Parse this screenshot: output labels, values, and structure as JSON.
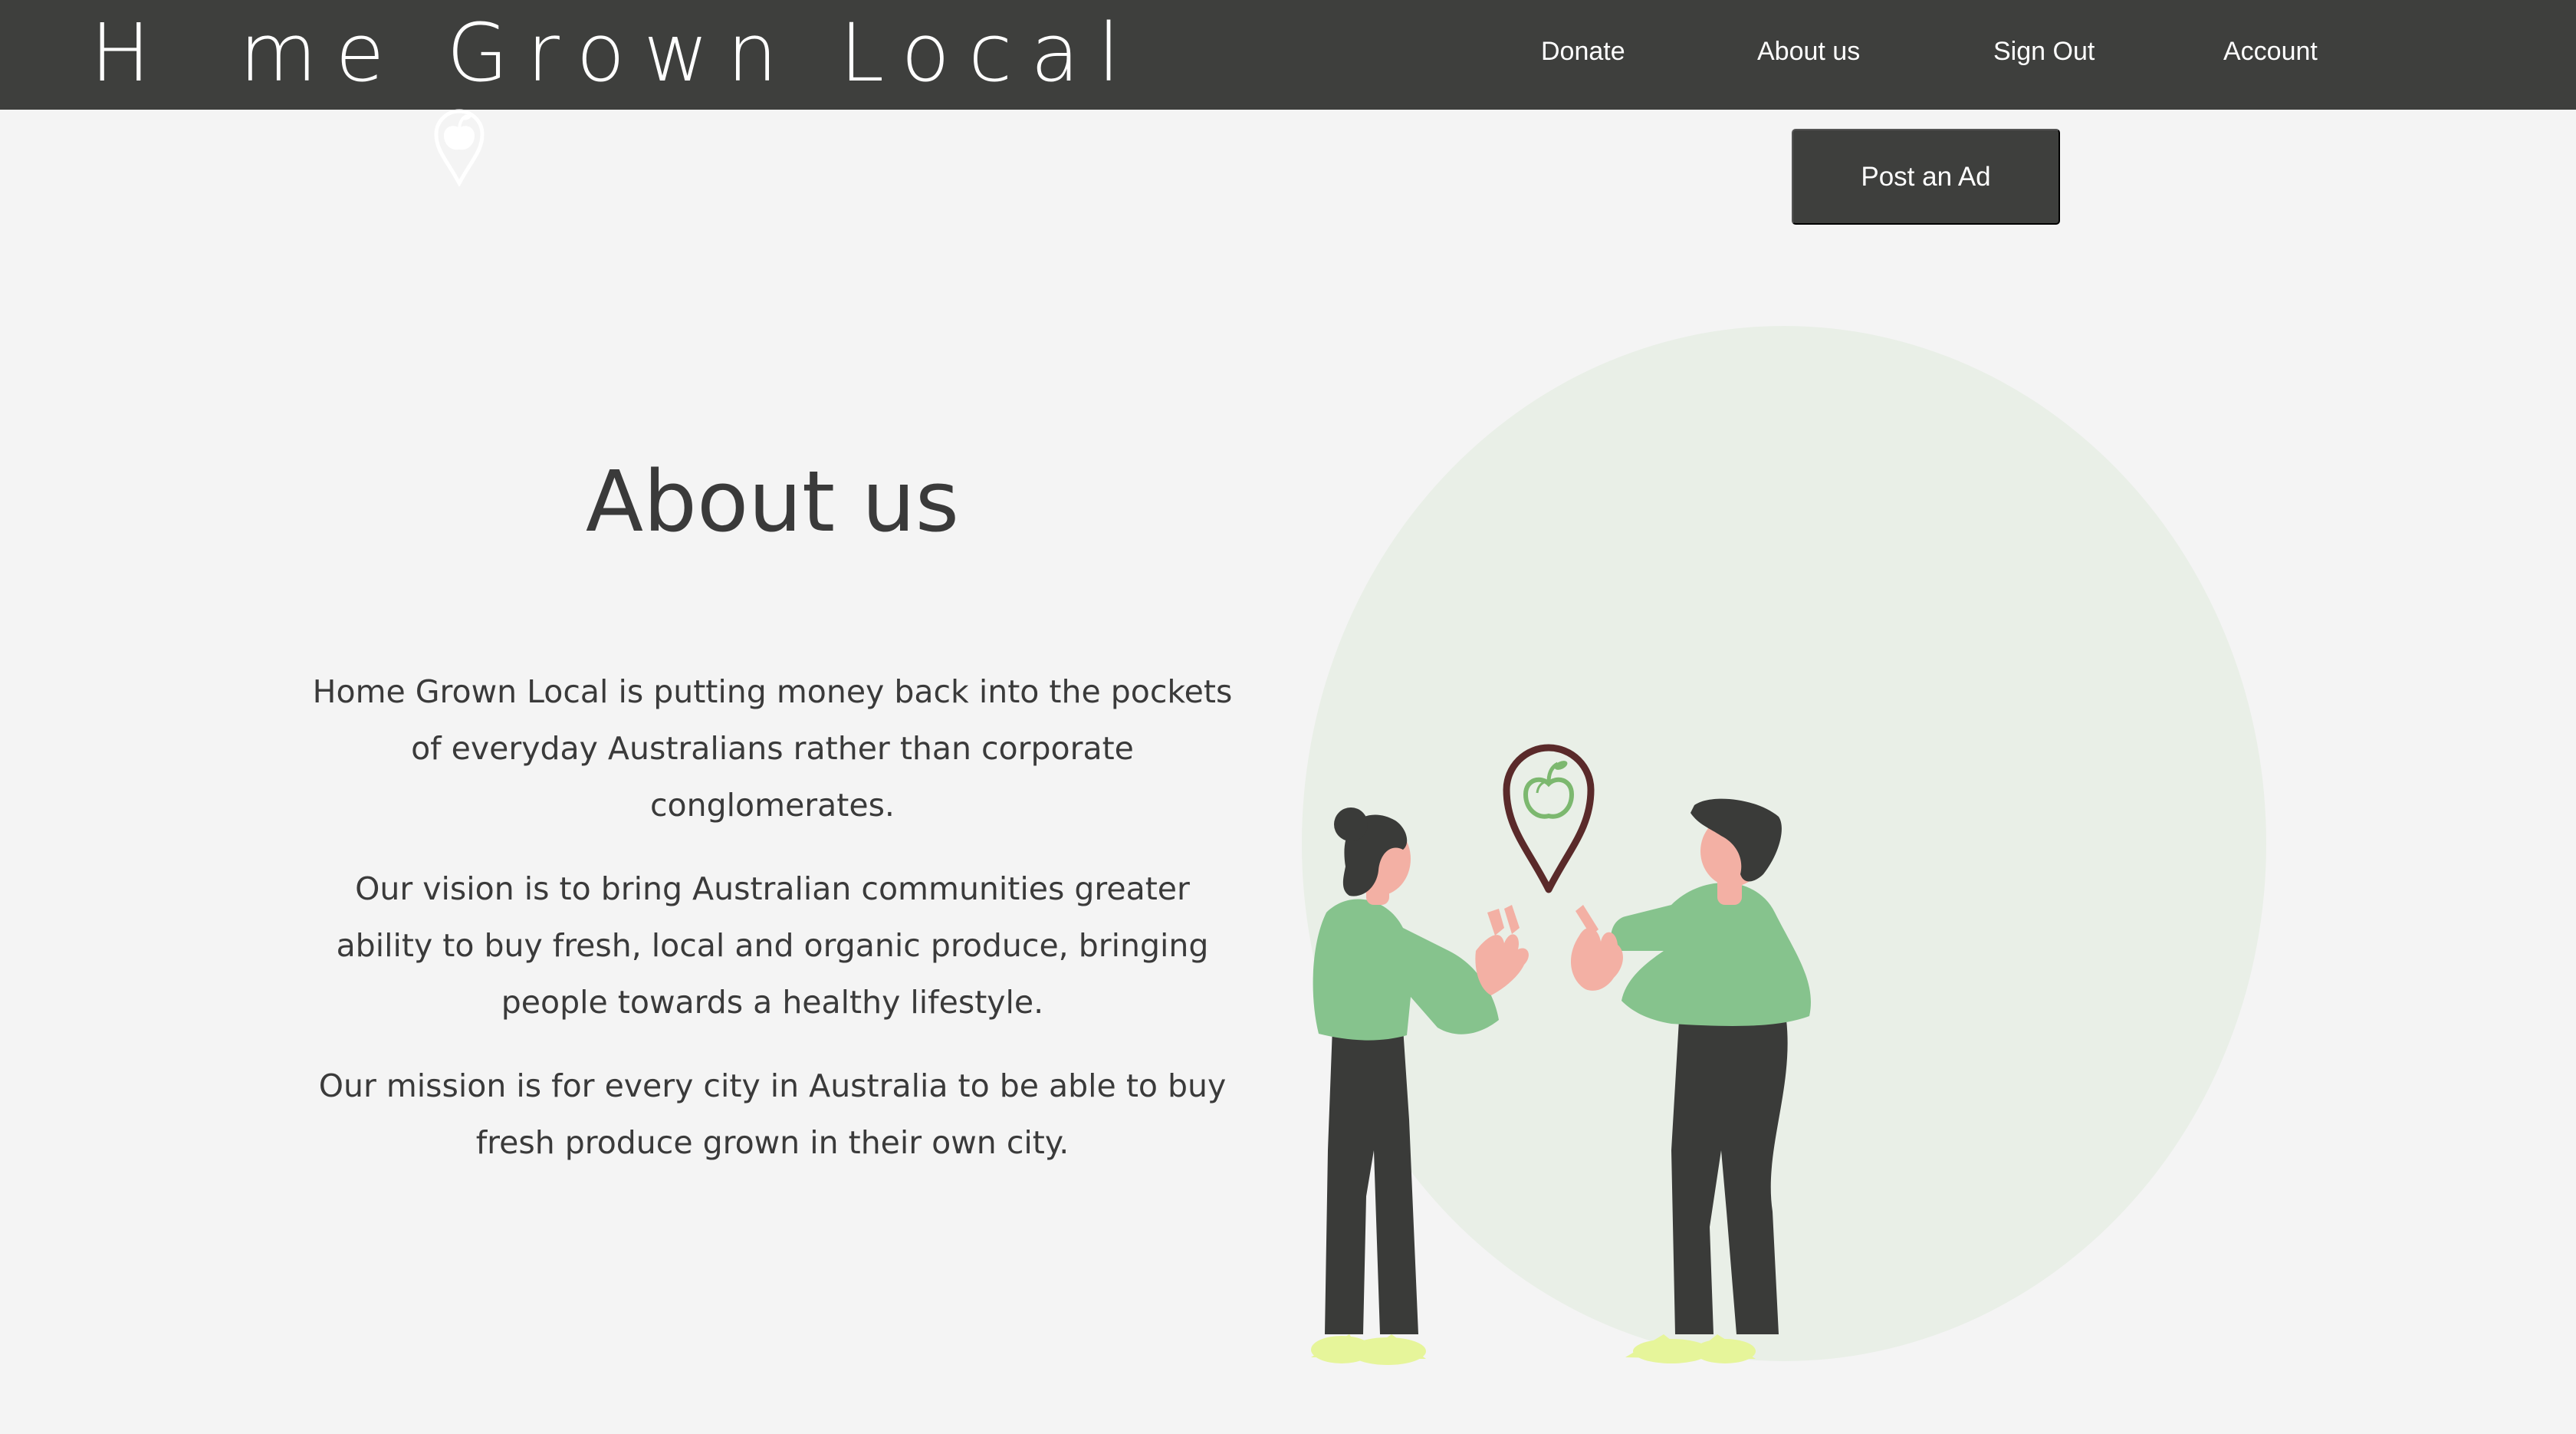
{
  "brand": {
    "name_part1": "H",
    "name_part2": "me Grown Local",
    "logo_icon": "apple-pin-icon"
  },
  "nav": {
    "items": [
      {
        "label": "Donate"
      },
      {
        "label": "About us"
      },
      {
        "label": "Sign Out"
      },
      {
        "label": "Account"
      }
    ]
  },
  "actions": {
    "post_ad_label": "Post an Ad"
  },
  "about": {
    "title": "About us",
    "paragraphs": [
      "Home Grown Local is putting money back into the pockets of everyday Australians rather than corporate conglomerates.",
      "Our vision is to bring Australian communities greater ability to buy fresh, local and organic produce, bringing people towards a healthy lifestyle.",
      "Our mission is for every city in Australia to be able to buy fresh produce grown in their own city."
    ]
  },
  "illustration": {
    "icon": "people-sharing-apple-pin-illustration"
  },
  "colors": {
    "navbar": "#3e3f3d",
    "background": "#f4f4f4",
    "circle": "#e9efe7",
    "shirt_green": "#86c38d",
    "pants": "#3a3b39",
    "shoes": "#e6f59a",
    "pin": "#5a2a2a",
    "apple": "#7cb86f",
    "skin": "#f3b0a4"
  }
}
